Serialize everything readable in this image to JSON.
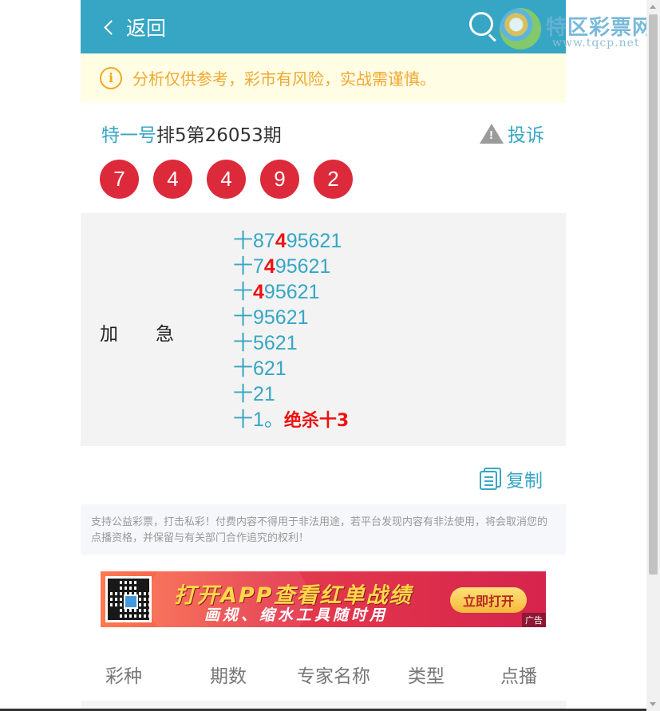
{
  "header": {
    "back_label": "返回"
  },
  "watermark": {
    "title": "特区彩票网",
    "subtitle": "www.tqcp.net"
  },
  "notice": {
    "text": "分析仅供参考，彩市有风险，实战需谨慎。"
  },
  "issue": {
    "expert": "特一号",
    "title": "排5第26053期",
    "complain_label": "投诉"
  },
  "balls": [
    "7",
    "4",
    "4",
    "9",
    "2"
  ],
  "plan": {
    "label_1": "加",
    "label_2": "急",
    "lines": [
      {
        "pre": "十87",
        "hl": "4",
        "post": "95621"
      },
      {
        "pre": "十7",
        "hl": "4",
        "post": "95621"
      },
      {
        "pre": "十",
        "hl": "4",
        "post": "95621"
      },
      {
        "pre": "十95621",
        "hl": "",
        "post": ""
      },
      {
        "pre": "十5621",
        "hl": "",
        "post": ""
      },
      {
        "pre": "十621",
        "hl": "",
        "post": ""
      },
      {
        "pre": "十21",
        "hl": "",
        "post": ""
      }
    ],
    "last_line_pre": "十1。",
    "last_line_kill": "绝杀十3"
  },
  "copy": {
    "label": "复制"
  },
  "disclaimer": {
    "text": "支持公益彩票，打击私彩！付费内容不得用于非法用途，若平台发现内容有非法使用，将会取消您的点播资格，并保留与有关部门合作追究的权利！"
  },
  "ad": {
    "title": "打开APP查看红单战绩",
    "subtitle": "画规、缩水工具随时用",
    "button": "立即打开",
    "tag": "广告"
  },
  "table": {
    "headers": [
      "彩种",
      "期数",
      "专家名称",
      "类型",
      "点播"
    ]
  },
  "colors": {
    "brand": "#36a6c4",
    "ball": "#dc2a3a",
    "highlight": "#ee1111",
    "notice_bg": "#fffde4",
    "notice_text": "#f0a832"
  }
}
